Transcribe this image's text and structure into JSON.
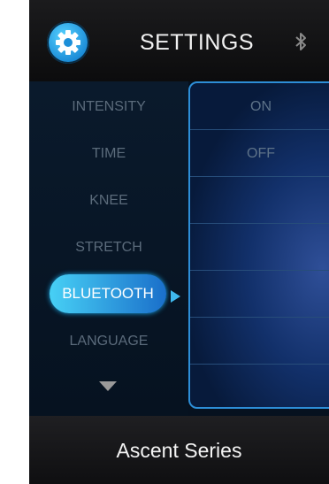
{
  "header": {
    "title": "SETTINGS",
    "settings_icon": "gear-icon",
    "status_icon": "bluetooth-icon"
  },
  "menu": {
    "items": [
      {
        "label": "INTENSITY"
      },
      {
        "label": "TIME"
      },
      {
        "label": "KNEE"
      },
      {
        "label": "STRETCH"
      },
      {
        "label": "BLUETOOTH",
        "selected": true
      },
      {
        "label": "LANGUAGE"
      }
    ],
    "scroll_icon": "triangle-down-icon",
    "pointer_icon": "triangle-right-icon"
  },
  "options": [
    {
      "label": "ON"
    },
    {
      "label": "OFF"
    }
  ],
  "footer": {
    "text": "Ascent Series"
  },
  "colors": {
    "accent": "#2d8ed7",
    "selected_start": "#47d0f5",
    "selected_end": "#1a6fca",
    "inactive_text": "#5b6b7b"
  }
}
